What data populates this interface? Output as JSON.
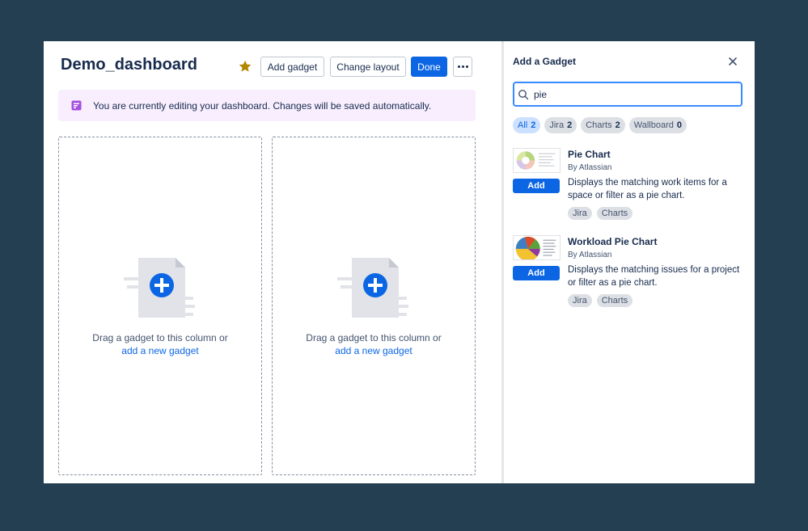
{
  "dashboard": {
    "title": "Demo_dashboard",
    "star_icon": "star-icon",
    "starred_color": "#b38600",
    "buttons": {
      "add_gadget": "Add gadget",
      "change_layout": "Change layout",
      "done": "Done",
      "more_icon": "more-icon"
    },
    "banner": {
      "icon": "edit-note-icon",
      "text": "You are currently editing your dashboard. Changes will be saved automatically."
    },
    "columns": [
      {
        "drag_text": "Drag a gadget to this column or",
        "link_text": "add a new gadget"
      },
      {
        "drag_text": "Drag a gadget to this column or",
        "link_text": "add a new gadget"
      }
    ]
  },
  "panel": {
    "title": "Add a Gadget",
    "close_icon": "close-icon",
    "search": {
      "value": "pie",
      "icon": "search-icon"
    },
    "filters": [
      {
        "label": "All",
        "count": "2",
        "active": true
      },
      {
        "label": "Jira",
        "count": "2",
        "active": false
      },
      {
        "label": "Charts",
        "count": "2",
        "active": false
      },
      {
        "label": "Wallboard",
        "count": "0",
        "active": false
      }
    ],
    "gadgets": [
      {
        "name": "Pie Chart",
        "by": "By Atlassian",
        "add_label": "Add",
        "description": "Displays the matching work items for a space or filter as a pie chart.",
        "tags": [
          "Jira",
          "Charts"
        ]
      },
      {
        "name": "Workload Pie Chart",
        "by": "By Atlassian",
        "add_label": "Add",
        "description": "Displays the matching issues for a project or filter as a pie chart.",
        "tags": [
          "Jira",
          "Charts"
        ]
      }
    ]
  },
  "colors": {
    "accent": "#0c66e4",
    "background": "#243f52",
    "banner_bg": "#f8eefe",
    "banner_icon": "#a54fe0"
  }
}
